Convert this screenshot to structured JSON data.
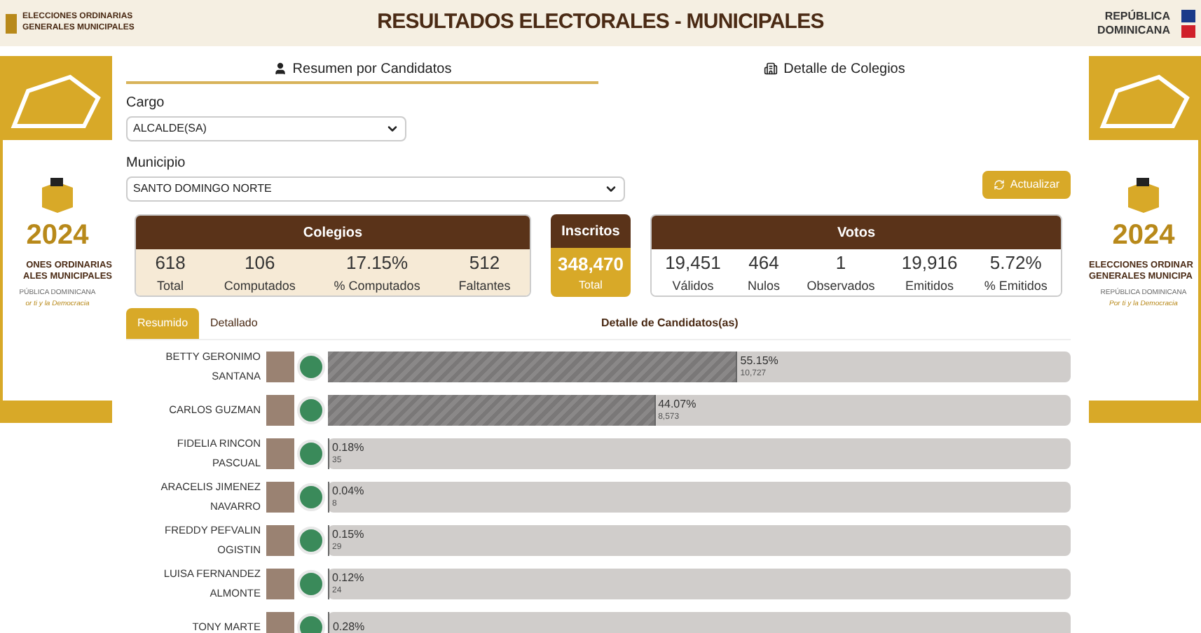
{
  "header": {
    "logo_text": [
      "ELECCIONES ORDINARIAS",
      "GENERALES MUNICIPALES"
    ],
    "title": "RESULTADOS ELECTORALES - MUNICIPALES",
    "country": [
      "REPÚBLICA",
      "DOMINICANA"
    ]
  },
  "main_tabs": [
    {
      "label": "Resumen por Candidatos",
      "selected": true,
      "kind": "person"
    },
    {
      "label": "Detalle de Colegios",
      "selected": false,
      "kind": "building"
    }
  ],
  "filters": [
    {
      "label": "Cargo",
      "value": "ALCALDE(SA)"
    },
    {
      "label": "Municipio",
      "value": "SANTO DOMINGO NORTE"
    }
  ],
  "refresh_button": "Actualizar",
  "colegios": {
    "title": "Colegios",
    "stats": [
      {
        "value": "618",
        "label": "Total"
      },
      {
        "value": "106",
        "label": "Computados"
      },
      {
        "value": "17.15%",
        "label": "% Computados"
      },
      {
        "value": "512",
        "label": "Faltantes"
      }
    ]
  },
  "inscritos": {
    "title": "Inscritos",
    "value": "348,470",
    "label": "Total"
  },
  "votos": {
    "title": "Votos",
    "stats": [
      {
        "value": "19,451",
        "label": "Válidos"
      },
      {
        "value": "464",
        "label": "Nulos"
      },
      {
        "value": "1",
        "label": "Observados"
      },
      {
        "value": "19,916",
        "label": "Emitidos"
      },
      {
        "value": "5.72%",
        "label": "% Emitidos"
      }
    ]
  },
  "detail_tabs": [
    {
      "label": "Resumido",
      "selected": true
    },
    {
      "label": "Detallado",
      "selected": false
    }
  ],
  "detail_title": "Detalle de Candidatos(as)",
  "candidates": [
    {
      "name": "BETTY GERONIMO SANTANA",
      "percent": "55.15%",
      "votes": "10,727",
      "level": 0.5515
    },
    {
      "name": "CARLOS GUZMAN",
      "percent": "44.07%",
      "votes": "8,573",
      "level": 0.4407
    },
    {
      "name": "FIDELIA RINCON PASCUAL",
      "percent": "0.18%",
      "votes": "35",
      "level": 0.0018
    },
    {
      "name": "ARACELIS JIMENEZ NAVARRO",
      "percent": "0.04%",
      "votes": "8",
      "level": 0.0004
    },
    {
      "name": "FREDDY PEFVALIN OGISTIN",
      "percent": "0.15%",
      "votes": "29",
      "level": 0.0015
    },
    {
      "name": "LUISA FERNANDEZ ALMONTE",
      "percent": "0.12%",
      "votes": "24",
      "level": 0.0012
    },
    {
      "name": "TONY MARTE",
      "percent": "0.28%",
      "level": 0.0028
    }
  ],
  "banners": [
    {
      "headline": [
        "ONES ORDINARIAS",
        "ALES MUNICIPALES"
      ],
      "sub": "PÚBLICA DOMINICANA",
      "slogan": "or ti y la Democracia",
      "year": "2024"
    },
    {
      "headline": [
        "ELECCIONES ORDINAR",
        "GENERALES MUNICIPA"
      ],
      "sub": "REPÚBLICA DOMINICANA",
      "slogan": "Por ti y la Democracia",
      "year": "2024"
    }
  ]
}
